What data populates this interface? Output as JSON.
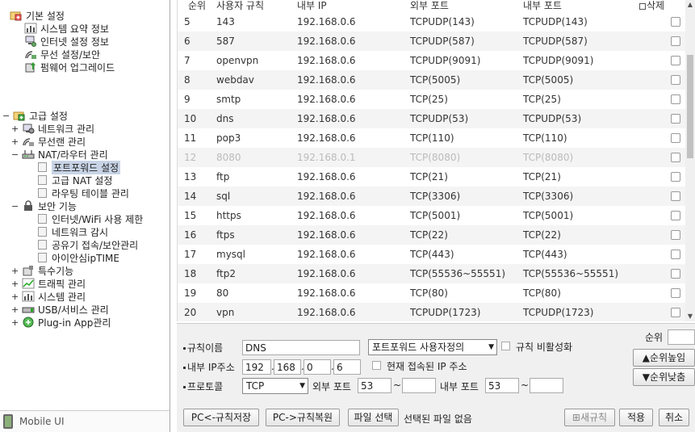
{
  "sidebar": {
    "basic": {
      "title": "기본 설정",
      "items": [
        "시스템 요약 정보",
        "인터넷 설정 정보",
        "무선 설정/보안",
        "펌웨어 업그레이드"
      ]
    },
    "advanced": {
      "title": "고급 설정",
      "items": [
        {
          "label": "네트워크 관리",
          "toggle": "+"
        },
        {
          "label": "무선랜 관리",
          "toggle": "+"
        },
        {
          "label": "NAT/라우터 관리",
          "toggle": "−"
        }
      ],
      "nat_children": [
        "포트포워드 설정",
        "고급 NAT 설정",
        "라우팅 테이블 관리"
      ],
      "security": {
        "label": "보안 기능",
        "toggle": "−"
      },
      "security_children": [
        "인터넷/WiFi 사용 제한",
        "네트워크 감시",
        "공유기 접속/보안관리",
        "아이안심ipTIME"
      ],
      "tail": [
        {
          "label": "특수기능",
          "toggle": "+"
        },
        {
          "label": "트래픽 관리",
          "toggle": "+"
        },
        {
          "label": "시스템 관리",
          "toggle": "+"
        },
        {
          "label": "USB/서비스 관리",
          "toggle": "+"
        },
        {
          "label": "Plug-in App관리",
          "toggle": "+"
        }
      ]
    },
    "mobile_ui": "Mobile UI"
  },
  "table": {
    "headers": {
      "seq": "순위",
      "name": "사용자 규칙",
      "ip": "내부 IP",
      "ext": "외부 포트",
      "int": "내부 포트",
      "del": "삭제"
    },
    "rows": [
      {
        "seq": "5",
        "name": "143",
        "ip": "192.168.0.6",
        "ext": "TCPUDP(143)",
        "int": "TCPUDP(143)",
        "disabled": false
      },
      {
        "seq": "6",
        "name": "587",
        "ip": "192.168.0.6",
        "ext": "TCPUDP(587)",
        "int": "TCPUDP(587)",
        "disabled": false
      },
      {
        "seq": "7",
        "name": "openvpn",
        "ip": "192.168.0.6",
        "ext": "TCPUDP(9091)",
        "int": "TCPUDP(9091)",
        "disabled": false
      },
      {
        "seq": "8",
        "name": "webdav",
        "ip": "192.168.0.6",
        "ext": "TCP(5005)",
        "int": "TCP(5005)",
        "disabled": false
      },
      {
        "seq": "9",
        "name": "smtp",
        "ip": "192.168.0.6",
        "ext": "TCP(25)",
        "int": "TCP(25)",
        "disabled": false
      },
      {
        "seq": "10",
        "name": "dns",
        "ip": "192.168.0.6",
        "ext": "TCPUDP(53)",
        "int": "TCPUDP(53)",
        "disabled": false
      },
      {
        "seq": "11",
        "name": "pop3",
        "ip": "192.168.0.6",
        "ext": "TCP(110)",
        "int": "TCP(110)",
        "disabled": false
      },
      {
        "seq": "12",
        "name": "8080",
        "ip": "192.168.0.1",
        "ext": "TCP(8080)",
        "int": "TCP(8080)",
        "disabled": true
      },
      {
        "seq": "13",
        "name": "ftp",
        "ip": "192.168.0.6",
        "ext": "TCP(21)",
        "int": "TCP(21)",
        "disabled": false
      },
      {
        "seq": "14",
        "name": "sql",
        "ip": "192.168.0.6",
        "ext": "TCP(3306)",
        "int": "TCP(3306)",
        "disabled": false
      },
      {
        "seq": "15",
        "name": "https",
        "ip": "192.168.0.6",
        "ext": "TCP(5001)",
        "int": "TCP(5001)",
        "disabled": false
      },
      {
        "seq": "16",
        "name": "ftps",
        "ip": "192.168.0.6",
        "ext": "TCP(22)",
        "int": "TCP(22)",
        "disabled": false
      },
      {
        "seq": "17",
        "name": "mysql",
        "ip": "192.168.0.6",
        "ext": "TCP(443)",
        "int": "TCP(443)",
        "disabled": false
      },
      {
        "seq": "18",
        "name": "ftp2",
        "ip": "192.168.0.6",
        "ext": "TCP(55536~55551)",
        "int": "TCP(55536~55551)",
        "disabled": false
      },
      {
        "seq": "19",
        "name": "80",
        "ip": "192.168.0.6",
        "ext": "TCP(80)",
        "int": "TCP(80)",
        "disabled": false
      },
      {
        "seq": "20",
        "name": "vpn",
        "ip": "192.168.0.6",
        "ext": "TCPUDP(1723)",
        "int": "TCPUDP(1723)",
        "disabled": false
      }
    ]
  },
  "form": {
    "rule_name_label": "규칙이름",
    "rule_name_value": "DNS",
    "preset_select": "포트포워드 사용자정의",
    "disable_rule_label": "규칙 비활성화",
    "internal_ip_label": "내부 IP주소",
    "ip": [
      "192",
      "168",
      "0",
      "6"
    ],
    "current_ip_label": "현재 접속된 IP 주소",
    "protocol_label": "프로토콜",
    "protocol_value": "TCP",
    "ext_port_label": "외부 포트",
    "ext_port_from": "53",
    "ext_port_to": "",
    "int_port_label": "내부 포트",
    "int_port_from": "53",
    "int_port_to": "",
    "range_sep": "~",
    "priority_label": "순위",
    "priority_value": "",
    "priority_up": "▲순위높임",
    "priority_down": "▼순위낮춤",
    "buttons": {
      "save_to_pc": "PC<-규칙저장",
      "restore_from_pc": "PC->규칙복원",
      "choose_file": "파일 선택",
      "no_file": "선택된 파일 없음",
      "new_rule": "새규칙",
      "apply": "적용",
      "cancel": "취소"
    }
  }
}
